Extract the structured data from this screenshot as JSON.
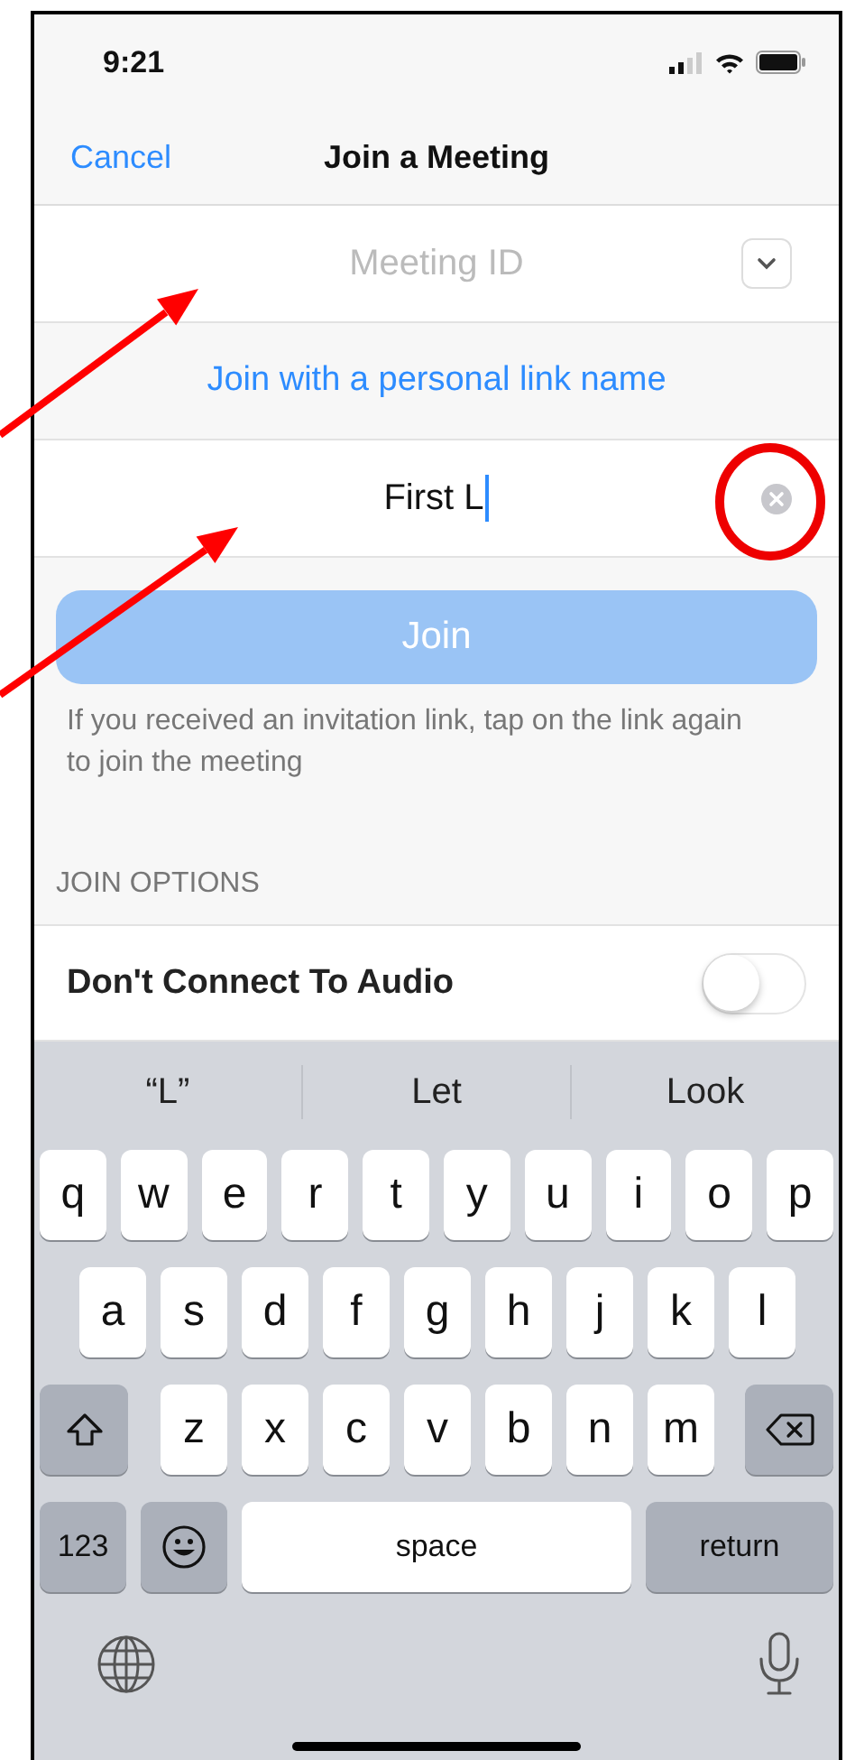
{
  "status_bar": {
    "time": "9:21"
  },
  "nav": {
    "cancel": "Cancel",
    "title": "Join a Meeting"
  },
  "meeting_id": {
    "placeholder": "Meeting ID"
  },
  "personal_link": "Join with a personal link name",
  "name_field": {
    "value": "First L"
  },
  "join_button": {
    "label": "Join",
    "disabled": true
  },
  "help_text": "If you received an invitation link, tap on the link again to join the meeting",
  "section_header": "JOIN OPTIONS",
  "options": [
    {
      "label": "Don't Connect To Audio",
      "on": false
    }
  ],
  "keyboard": {
    "suggestions": [
      "“L”",
      "Let",
      "Look"
    ],
    "rows": [
      {
        "keys": [
          {
            "kind": "letter",
            "label": "q"
          },
          {
            "kind": "letter",
            "label": "w"
          },
          {
            "kind": "letter",
            "label": "e"
          },
          {
            "kind": "letter",
            "label": "r"
          },
          {
            "kind": "letter",
            "label": "t"
          },
          {
            "kind": "letter",
            "label": "y"
          },
          {
            "kind": "letter",
            "label": "u"
          },
          {
            "kind": "letter",
            "label": "i"
          },
          {
            "kind": "letter",
            "label": "o"
          },
          {
            "kind": "letter",
            "label": "p"
          }
        ]
      },
      {
        "keys": [
          {
            "kind": "letter",
            "label": "a"
          },
          {
            "kind": "letter",
            "label": "s"
          },
          {
            "kind": "letter",
            "label": "d"
          },
          {
            "kind": "letter",
            "label": "f"
          },
          {
            "kind": "letter",
            "label": "g"
          },
          {
            "kind": "letter",
            "label": "h"
          },
          {
            "kind": "letter",
            "label": "j"
          },
          {
            "kind": "letter",
            "label": "k"
          },
          {
            "kind": "letter",
            "label": "l"
          }
        ]
      },
      {
        "keys": [
          {
            "kind": "shift"
          },
          {
            "kind": "letter",
            "label": "z"
          },
          {
            "kind": "letter",
            "label": "x"
          },
          {
            "kind": "letter",
            "label": "c"
          },
          {
            "kind": "letter",
            "label": "v"
          },
          {
            "kind": "letter",
            "label": "b"
          },
          {
            "kind": "letter",
            "label": "n"
          },
          {
            "kind": "letter",
            "label": "m"
          },
          {
            "kind": "delete"
          }
        ]
      },
      {
        "keys": [
          {
            "kind": "numbers",
            "label": "123"
          },
          {
            "kind": "emoji"
          },
          {
            "kind": "space",
            "label": "space"
          },
          {
            "kind": "return",
            "label": "return"
          }
        ]
      }
    ]
  }
}
